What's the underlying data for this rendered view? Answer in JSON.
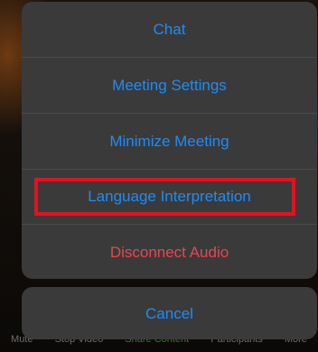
{
  "menu": {
    "items": [
      {
        "label": "Chat"
      },
      {
        "label": "Meeting Settings"
      },
      {
        "label": "Minimize Meeting"
      },
      {
        "label": "Language Interpretation"
      },
      {
        "label": "Disconnect Audio"
      }
    ],
    "cancel_label": "Cancel"
  },
  "toolbar": {
    "items": [
      "Mute",
      "Stop Video",
      "Share Content",
      "Participants",
      "More"
    ]
  },
  "colors": {
    "action": "#1f8cf5",
    "destructive": "#e5484d",
    "highlight": "#e3121e",
    "sheet": "#3a3a3b"
  }
}
